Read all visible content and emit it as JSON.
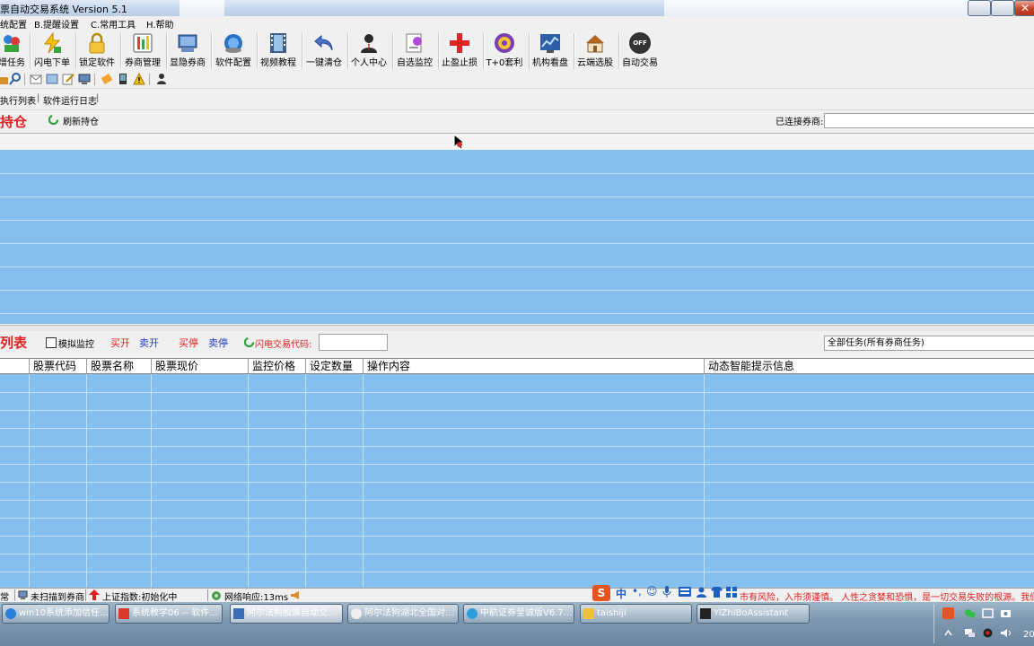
{
  "window": {
    "title": "票自动交易系统 Version 5.1"
  },
  "menu": [
    {
      "label": "统配置"
    },
    {
      "label": "B.提醒设置"
    },
    {
      "label": "C.常用工具"
    },
    {
      "label": "H.帮助"
    }
  ],
  "toolbar": [
    {
      "label": "增任务",
      "icon": "add-task-icon"
    },
    {
      "label": "闪电下单",
      "icon": "lightning-order-icon"
    },
    {
      "label": "锁定软件",
      "icon": "lock-icon"
    },
    {
      "label": "券商管理",
      "icon": "broker-manage-icon"
    },
    {
      "label": "显隐券商",
      "icon": "show-hide-broker-icon"
    },
    {
      "label": "软件配置",
      "icon": "config-globe-icon"
    },
    {
      "label": "视频教程",
      "icon": "video-film-icon"
    },
    {
      "label": "一键清仓",
      "icon": "undo-arrow-icon"
    },
    {
      "label": "个人中心",
      "icon": "person-icon"
    },
    {
      "label": "自选监控",
      "icon": "monitor-icon"
    },
    {
      "label": "止盈止损",
      "icon": "red-cross-icon"
    },
    {
      "label": "T+0套利",
      "icon": "t0-arbitrage-icon"
    },
    {
      "label": "机构看盘",
      "icon": "chart-screen-icon"
    },
    {
      "label": "云端选股",
      "icon": "cloud-house-icon"
    },
    {
      "label": "自动交易",
      "icon": "off-toggle-icon",
      "badge": "OFF"
    }
  ],
  "tabs": [
    "执行列表",
    "软件运行日志"
  ],
  "positions": {
    "title": "持仓",
    "refresh_label": "刷新持仓",
    "broker_label": "已连接券商:"
  },
  "tasks": {
    "title": "列表",
    "sim_monitor_label": "模拟监控",
    "buy_open": "买开",
    "sell_open": "卖开",
    "buy_stop": "买停",
    "sell_stop": "卖停",
    "flash_code_label": "闪电交易代码:",
    "filter_value": "全部任务(所有券商任务)",
    "columns": [
      "股票代码",
      "股票名称",
      "股票现价",
      "监控价格",
      "设定数量",
      "操作内容",
      "动态智能提示信息"
    ]
  },
  "status": {
    "s0": "常",
    "s1": "未扫描到券商",
    "s2": "上证指数:初始化中",
    "s3": "网络响应:13ms",
    "ime": "中",
    "marquee": "市有风险，入市须谨慎。    人性之贪婪和恐惧，是一切交易失败的根源。我们"
  },
  "taskbar": [
    {
      "label": "win10系统添加信任..."
    },
    {
      "label": "系统教学06 -- 软件..."
    },
    {
      "label": "阿尔法狗股票自动交..."
    },
    {
      "label": "阿尔法狗湖北全国对..."
    },
    {
      "label": "中航证券至诚版V6.7..."
    },
    {
      "label": "taishiji"
    },
    {
      "label": "YiZhiBoAssistant"
    }
  ],
  "clock": "20"
}
